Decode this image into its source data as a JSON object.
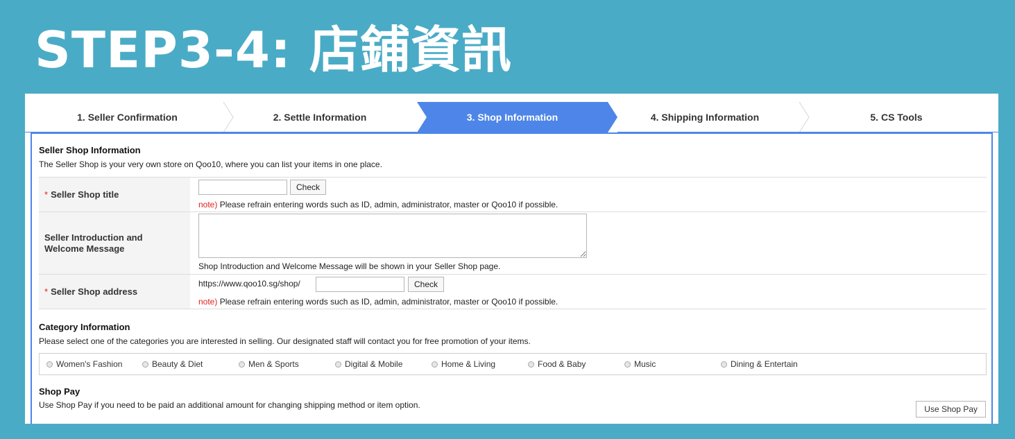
{
  "banner": {
    "title": "STEP3-4: 店鋪資訊"
  },
  "steps": [
    {
      "label": "1. Seller Confirmation",
      "active": false
    },
    {
      "label": "2. Settle Information",
      "active": false
    },
    {
      "label": "3. Shop Information",
      "active": true
    },
    {
      "label": "4. Shipping Information",
      "active": false
    },
    {
      "label": "5. CS Tools",
      "active": false
    }
  ],
  "colors": {
    "background": "#4aabc6",
    "active_step": "#4d86e8",
    "required_mark": "#e02020",
    "note_label": "#e02020"
  },
  "seller_shop": {
    "title": "Seller Shop Information",
    "desc": "The Seller Shop is your very own store on Qoo10, where you can list your items in one place.",
    "rows": {
      "shop_title": {
        "required": "*",
        "label": "Seller Shop title",
        "value": "",
        "check_label": "Check",
        "note_prefix": "note)",
        "note": " Please refrain entering words such as ID, admin, administrator, master or Qoo10 if possible."
      },
      "intro": {
        "label": "Seller Introduction and Welcome Message",
        "value": "",
        "help": "Shop Introduction and Welcome Message will be shown in your Seller Shop page."
      },
      "address": {
        "required": "*",
        "label": "Seller Shop address",
        "url_prefix": "https://www.qoo10.sg/shop/",
        "value": "",
        "check_label": "Check",
        "note_prefix": "note)",
        "note": " Please refrain entering words such as ID, admin, administrator, master or Qoo10 if possible."
      }
    }
  },
  "category": {
    "title": "Category Information",
    "desc": "Please select one of the categories you are interested in selling. Our designated staff will contact you for free promotion of your items.",
    "options": [
      "Women's Fashion",
      "Beauty & Diet",
      "Men & Sports",
      "Digital & Mobile",
      "Home & Living",
      "Food & Baby",
      "Music",
      "Dining & Entertain"
    ],
    "selected": null
  },
  "shop_pay": {
    "title": "Shop Pay",
    "desc": "Use Shop Pay if you need to be paid an additional amount for changing shipping method or item option.",
    "button_label": "Use Shop Pay"
  }
}
